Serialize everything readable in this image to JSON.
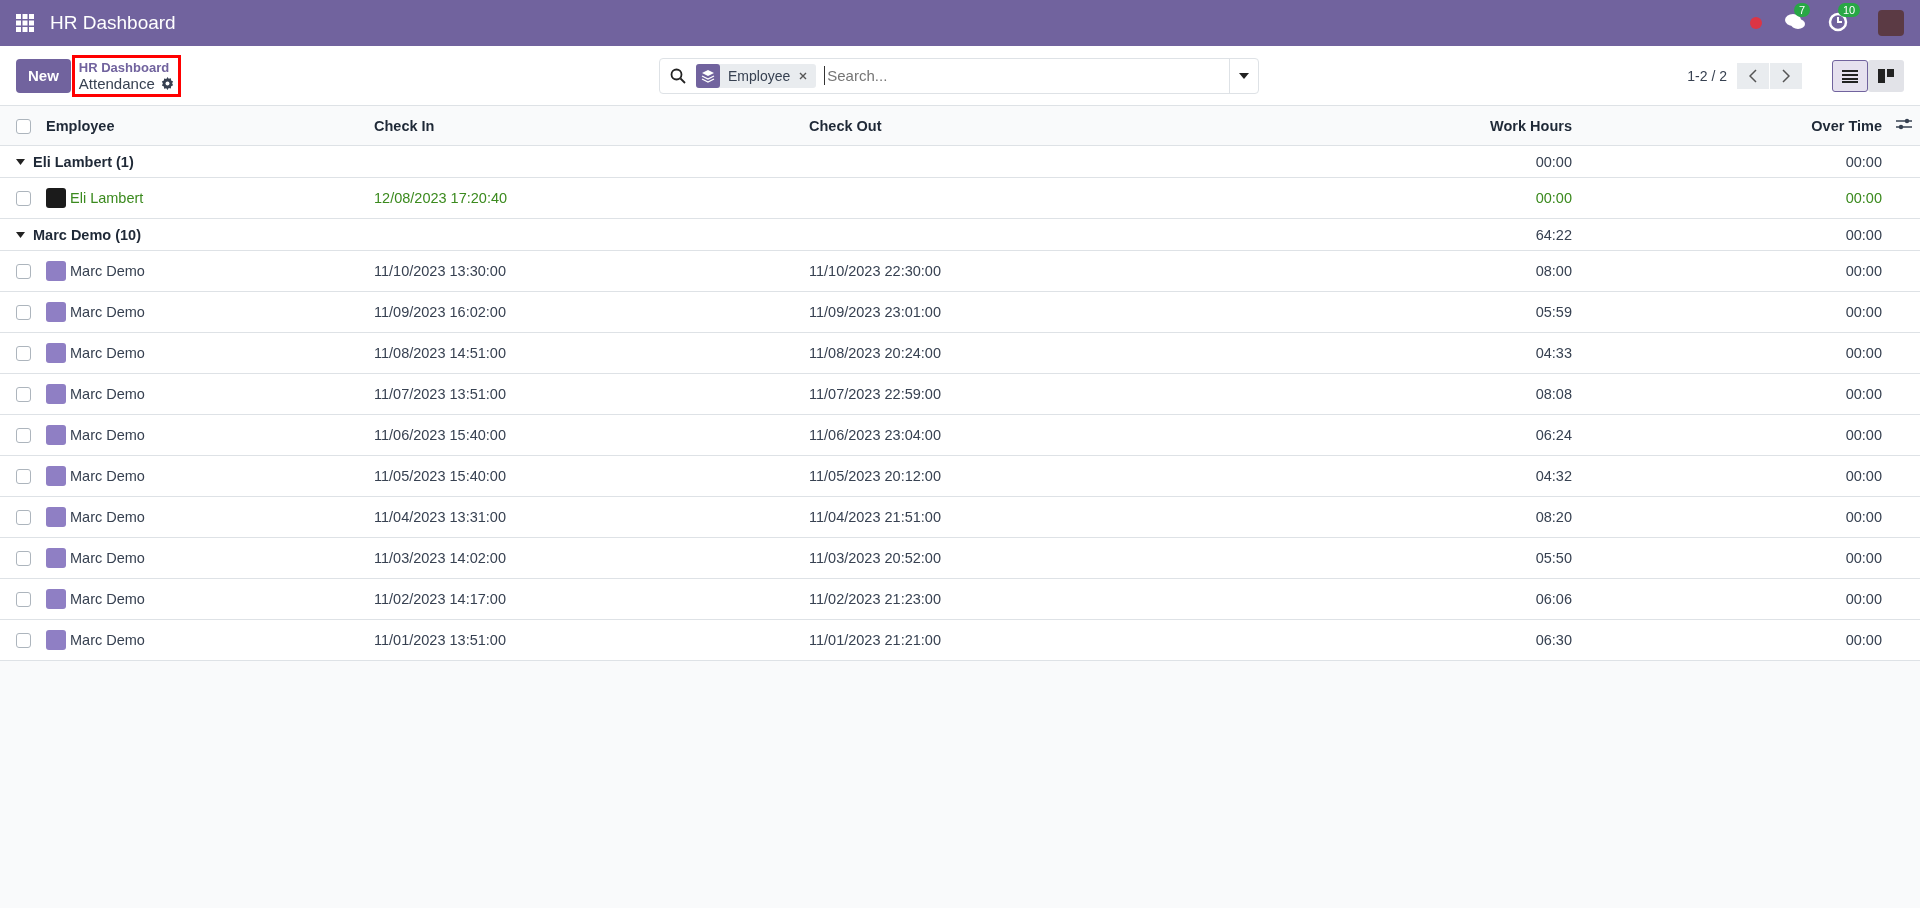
{
  "navbar": {
    "app_title": "HR Dashboard",
    "messages_badge": "7",
    "activities_badge": "10"
  },
  "control_panel": {
    "new_button": "New",
    "breadcrumb": {
      "parent": "HR Dashboard",
      "current": "Attendance",
      "highlighted": true
    },
    "search": {
      "facets": [
        {
          "label": "Employee"
        }
      ],
      "placeholder": "Search..."
    },
    "pager": "1-2 / 2",
    "views": [
      {
        "kind": "list",
        "selected": true
      },
      {
        "kind": "kanban",
        "selected": false
      }
    ]
  },
  "table": {
    "columns": [
      "Employee",
      "Check In",
      "Check Out",
      "Work Hours",
      "Over Time"
    ],
    "all_checked": false,
    "groups": [
      {
        "name": "Eli Lambert (1)",
        "expanded": true,
        "work_hours": "00:00",
        "over_time": "00:00",
        "rows": [
          {
            "employee": "Eli Lambert",
            "kind": "photo",
            "checked_in": true,
            "checked": false,
            "check_in": "12/08/2023 17:20:40",
            "check_out": "",
            "work_hours": "00:00",
            "over_time": "00:00"
          }
        ]
      },
      {
        "name": "Marc Demo (10)",
        "expanded": true,
        "work_hours": "64:22",
        "over_time": "00:00",
        "rows": [
          {
            "employee": "Marc Demo",
            "kind": "cartoon",
            "checked_in": false,
            "checked": false,
            "check_in": "11/10/2023 13:30:00",
            "check_out": "11/10/2023 22:30:00",
            "work_hours": "08:00",
            "over_time": "00:00"
          },
          {
            "employee": "Marc Demo",
            "kind": "cartoon",
            "checked_in": false,
            "checked": false,
            "check_in": "11/09/2023 16:02:00",
            "check_out": "11/09/2023 23:01:00",
            "work_hours": "05:59",
            "over_time": "00:00"
          },
          {
            "employee": "Marc Demo",
            "kind": "cartoon",
            "checked_in": false,
            "checked": false,
            "check_in": "11/08/2023 14:51:00",
            "check_out": "11/08/2023 20:24:00",
            "work_hours": "04:33",
            "over_time": "00:00"
          },
          {
            "employee": "Marc Demo",
            "kind": "cartoon",
            "checked_in": false,
            "checked": false,
            "check_in": "11/07/2023 13:51:00",
            "check_out": "11/07/2023 22:59:00",
            "work_hours": "08:08",
            "over_time": "00:00"
          },
          {
            "employee": "Marc Demo",
            "kind": "cartoon",
            "checked_in": false,
            "checked": false,
            "check_in": "11/06/2023 15:40:00",
            "check_out": "11/06/2023 23:04:00",
            "work_hours": "06:24",
            "over_time": "00:00"
          },
          {
            "employee": "Marc Demo",
            "kind": "cartoon",
            "checked_in": false,
            "checked": false,
            "check_in": "11/05/2023 15:40:00",
            "check_out": "11/05/2023 20:12:00",
            "work_hours": "04:32",
            "over_time": "00:00"
          },
          {
            "employee": "Marc Demo",
            "kind": "cartoon",
            "checked_in": false,
            "checked": false,
            "check_in": "11/04/2023 13:31:00",
            "check_out": "11/04/2023 21:51:00",
            "work_hours": "08:20",
            "over_time": "00:00"
          },
          {
            "employee": "Marc Demo",
            "kind": "cartoon",
            "checked_in": false,
            "checked": false,
            "check_in": "11/03/2023 14:02:00",
            "check_out": "11/03/2023 20:52:00",
            "work_hours": "05:50",
            "over_time": "00:00"
          },
          {
            "employee": "Marc Demo",
            "kind": "cartoon",
            "checked_in": false,
            "checked": false,
            "check_in": "11/02/2023 14:17:00",
            "check_out": "11/02/2023 21:23:00",
            "work_hours": "06:06",
            "over_time": "00:00"
          },
          {
            "employee": "Marc Demo",
            "kind": "cartoon",
            "checked_in": false,
            "checked": false,
            "check_in": "11/01/2023 13:51:00",
            "check_out": "11/01/2023 21:21:00",
            "work_hours": "06:30",
            "over_time": "00:00"
          }
        ]
      }
    ]
  }
}
